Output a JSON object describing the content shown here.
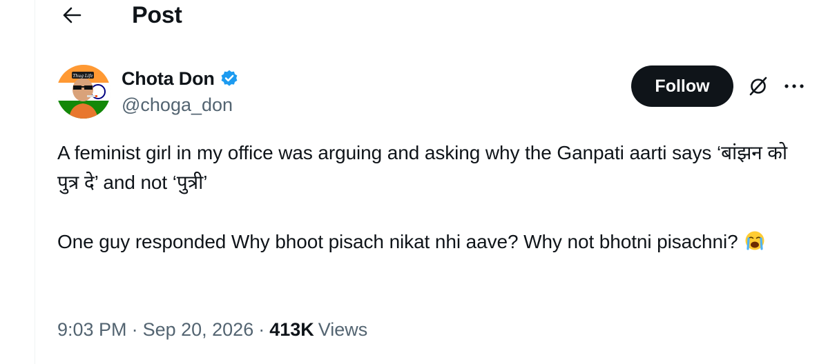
{
  "header": {
    "title": "Post",
    "back_icon": "arrow-left-icon"
  },
  "post": {
    "author": {
      "name": "Chota Don",
      "handle": "@choga_don",
      "verified": true,
      "verified_color": "#1d9bf0",
      "avatar_caption": "Thug Life"
    },
    "follow_label": "Follow",
    "grok_icon": "slashed-circle-icon",
    "more_icon": "more-horizontal-icon",
    "text": {
      "paragraph_1": "A feminist girl in my office was arguing and asking why the Ganpati aarti says ‘बांझन को पुत्र दे’ and not ‘पुत्री’",
      "paragraph_2": "One guy responded Why bhoot pisach nikat nhi aave? Why not bhotni pisachni?",
      "emoji": "loudly-crying-face"
    },
    "meta": {
      "time": "9:03 PM",
      "separator": "·",
      "date": "Sep 20, 2026",
      "views_count": "413K",
      "views_label": "Views"
    }
  },
  "colors": {
    "text_primary": "#0f1419",
    "text_secondary": "#536471",
    "follow_bg": "#0f1419",
    "accent": "#1d9bf0"
  }
}
